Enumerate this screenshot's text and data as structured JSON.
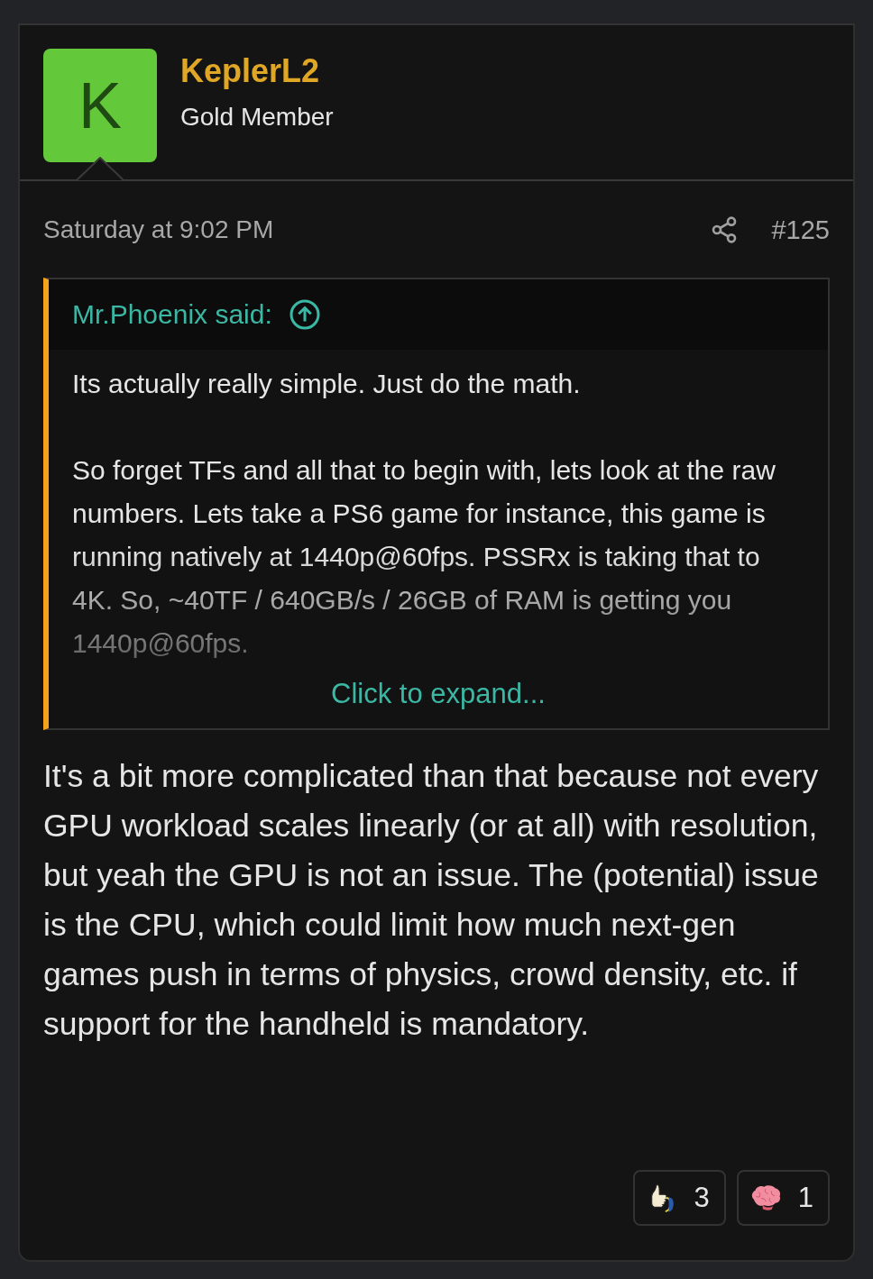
{
  "author": {
    "avatar_letter": "K",
    "name": "KeplerL2",
    "title": "Gold Member"
  },
  "post": {
    "date": "Saturday at 9:02 PM",
    "number": "#125"
  },
  "quote": {
    "author": "Mr.Phoenix said:",
    "paragraphs": [
      "Its actually really simple. Just do the math.",
      "So forget TFs and all that to begin with, lets look at the raw numbers. Lets take a PS6 game for instance, this game is running natively at 1440p@60fps. PSSRx is taking that to 4K. So, ~40TF / 640GB/s / 26GB of RAM is getting you 1440p@60fps."
    ],
    "expand": "Click to expand..."
  },
  "body": "It's a bit more complicated than that because not every GPU workload scales linearly (or at all) with resolution, but yeah the GPU is not an issue. The (potential) issue is the CPU, which could limit how much next-gen games push in terms of physics, crowd density, etc. if support for the handheld is mandatory.",
  "reactions": [
    {
      "kind": "like",
      "count": "3"
    },
    {
      "kind": "brain",
      "count": "1"
    }
  ]
}
